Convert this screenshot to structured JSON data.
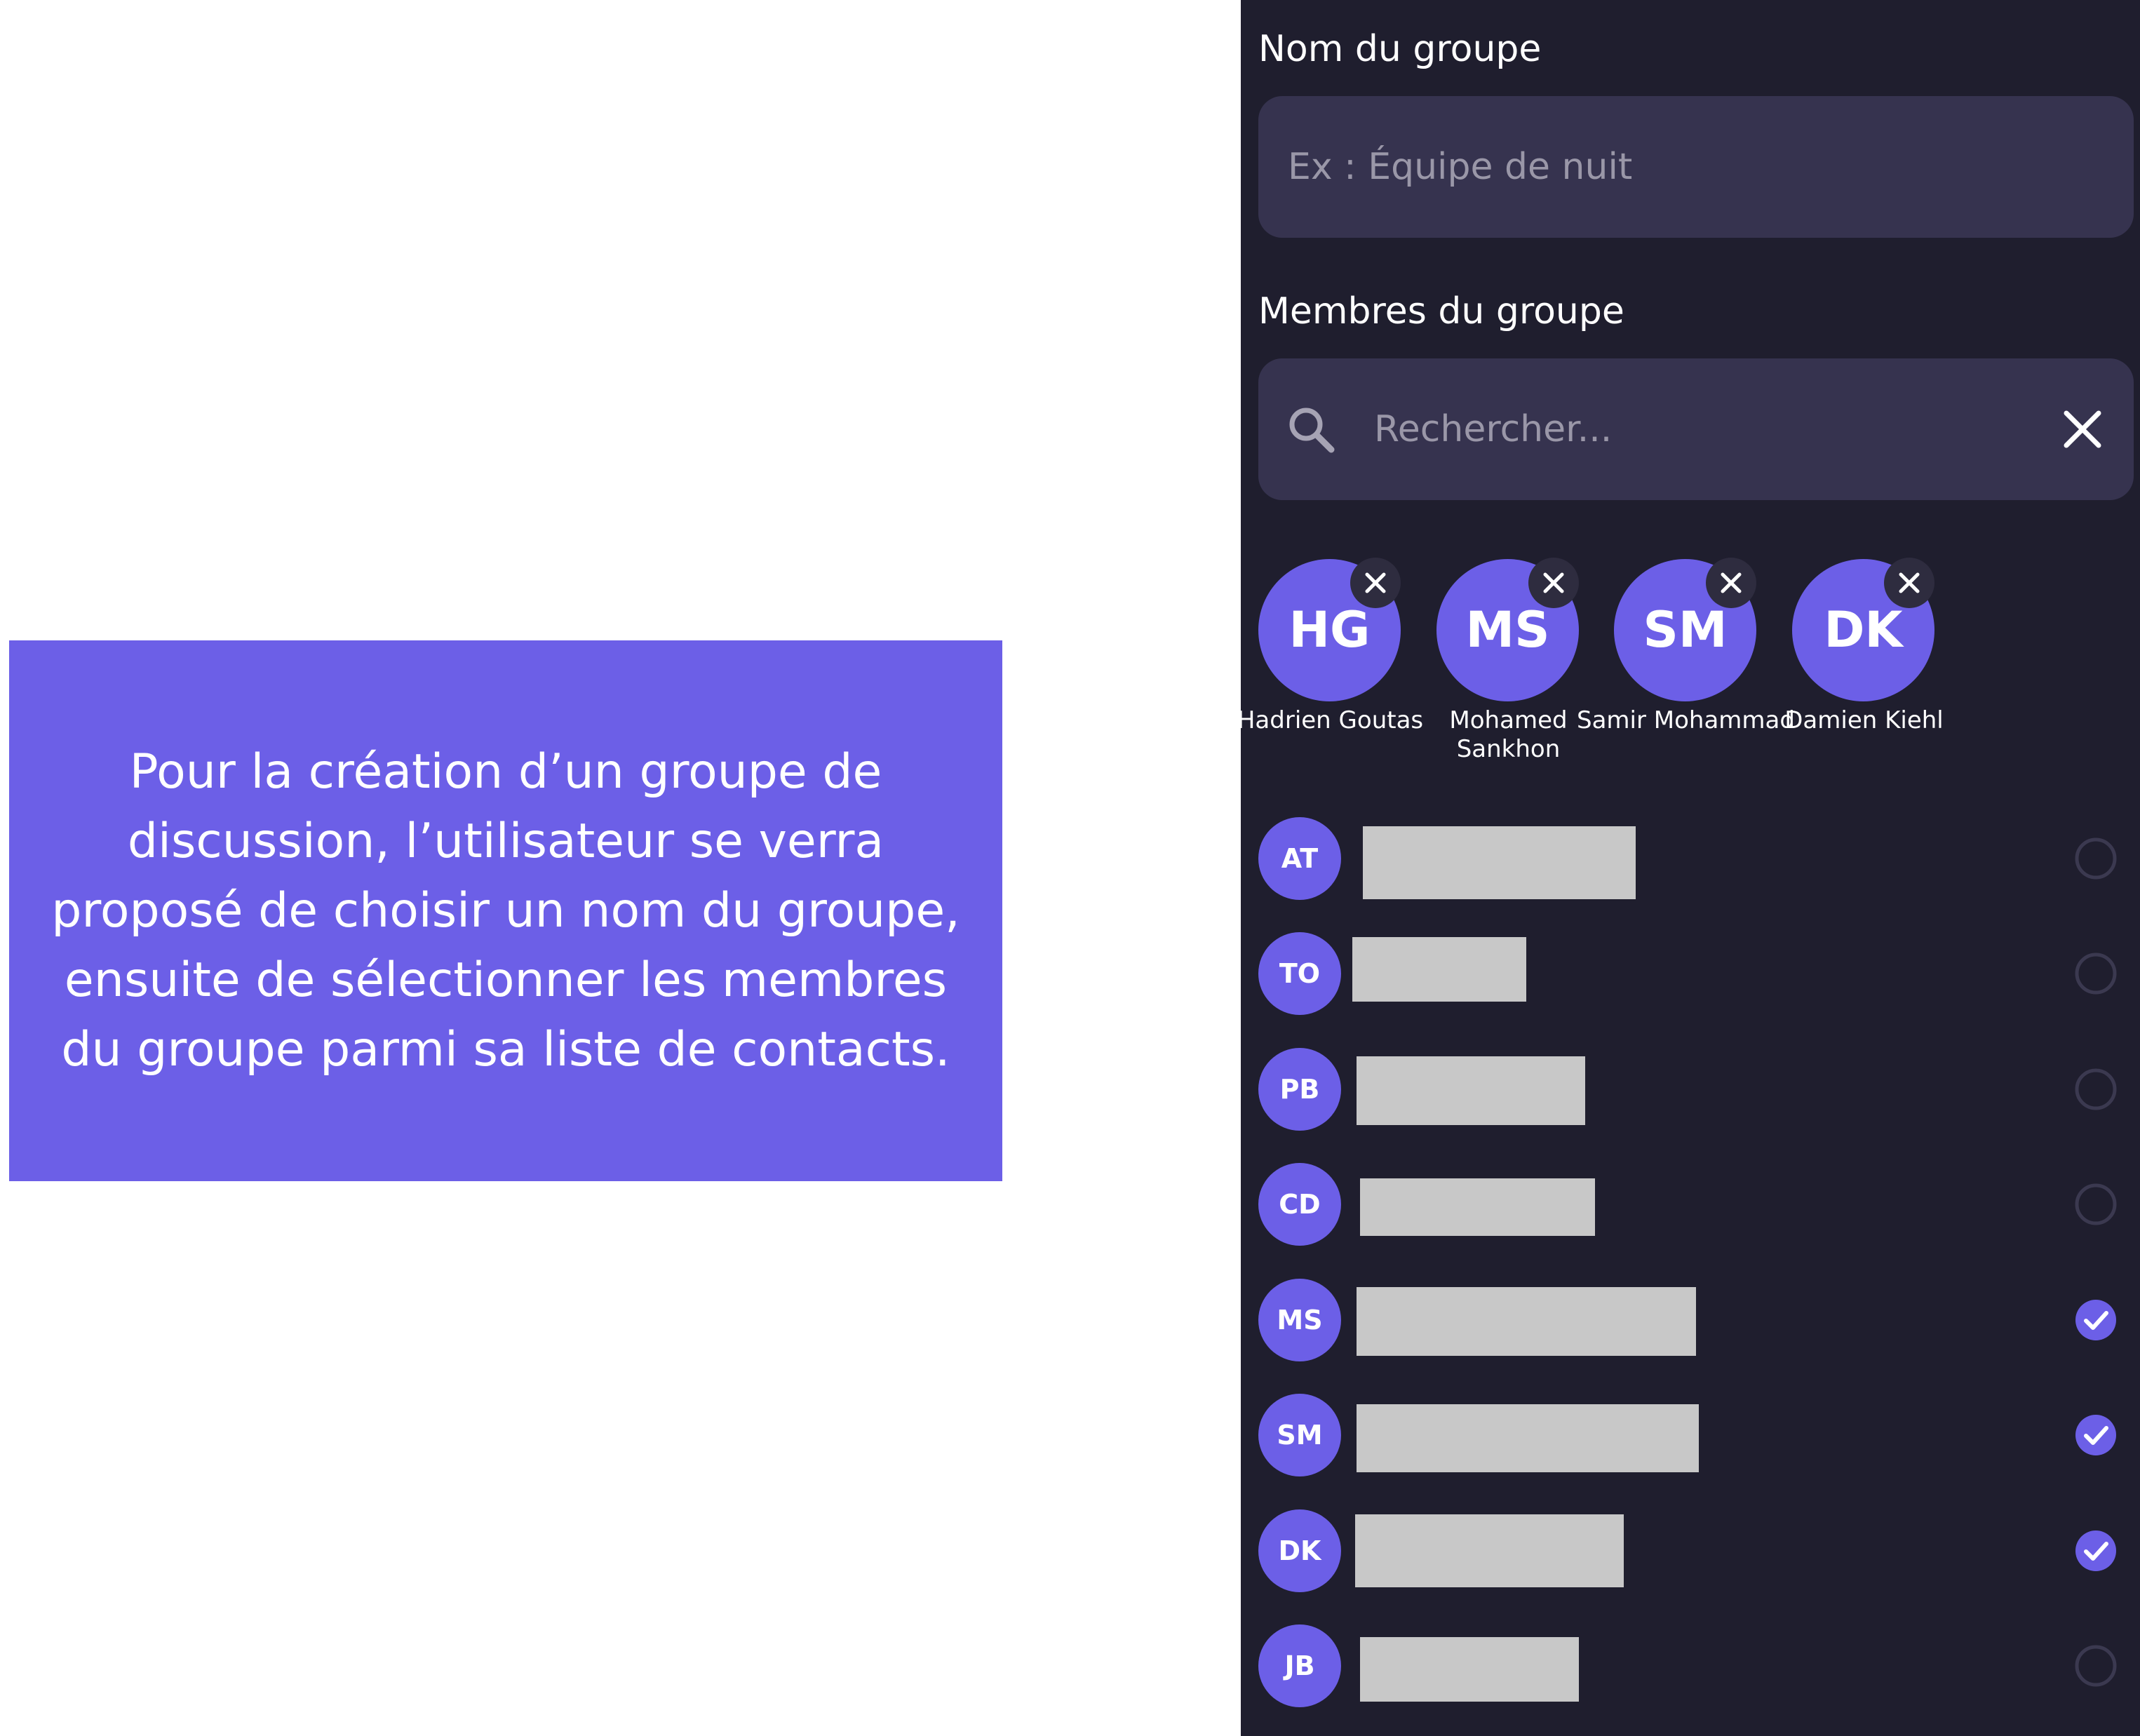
{
  "description_box": {
    "text": "Pour la création d’un groupe de discussion, l’utilisateur se verra proposé de choisir un nom du groupe, ensuite de sélectionner les membres du groupe parmi sa liste de contacts.",
    "background": "#6c5fe7"
  },
  "group_form": {
    "name_label": "Nom du groupe",
    "name_placeholder": "Ex : Équipe de nuit",
    "members_label": "Membres du groupe",
    "search_placeholder": "Rechercher..."
  },
  "selected_members": [
    {
      "initials": "HG",
      "name": "Hadrien Goutas"
    },
    {
      "initials": "MS",
      "name": "Mohamed Sankhon"
    },
    {
      "initials": "SM",
      "name": "Samir Mohammad"
    },
    {
      "initials": "DK",
      "name": "Damien Kiehl"
    }
  ],
  "contacts": [
    {
      "initials": "AT",
      "selected": false
    },
    {
      "initials": "TO",
      "selected": false
    },
    {
      "initials": "PB",
      "selected": false
    },
    {
      "initials": "CD",
      "selected": false
    },
    {
      "initials": "MS",
      "selected": true
    },
    {
      "initials": "SM",
      "selected": true
    },
    {
      "initials": "DK",
      "selected": true
    },
    {
      "initials": "JB",
      "selected": false
    }
  ],
  "colors": {
    "accent": "#6c5fe7",
    "panel_background": "#1f1e2e",
    "field_background": "#36334f",
    "placeholder_text": "#9a97a8",
    "redaction": "#c8c8c8"
  },
  "icons": {
    "search": "search-icon",
    "clear": "close-icon",
    "chip_remove": "close-icon",
    "selected": "check-circle-icon",
    "unselected": "empty-circle-icon"
  }
}
